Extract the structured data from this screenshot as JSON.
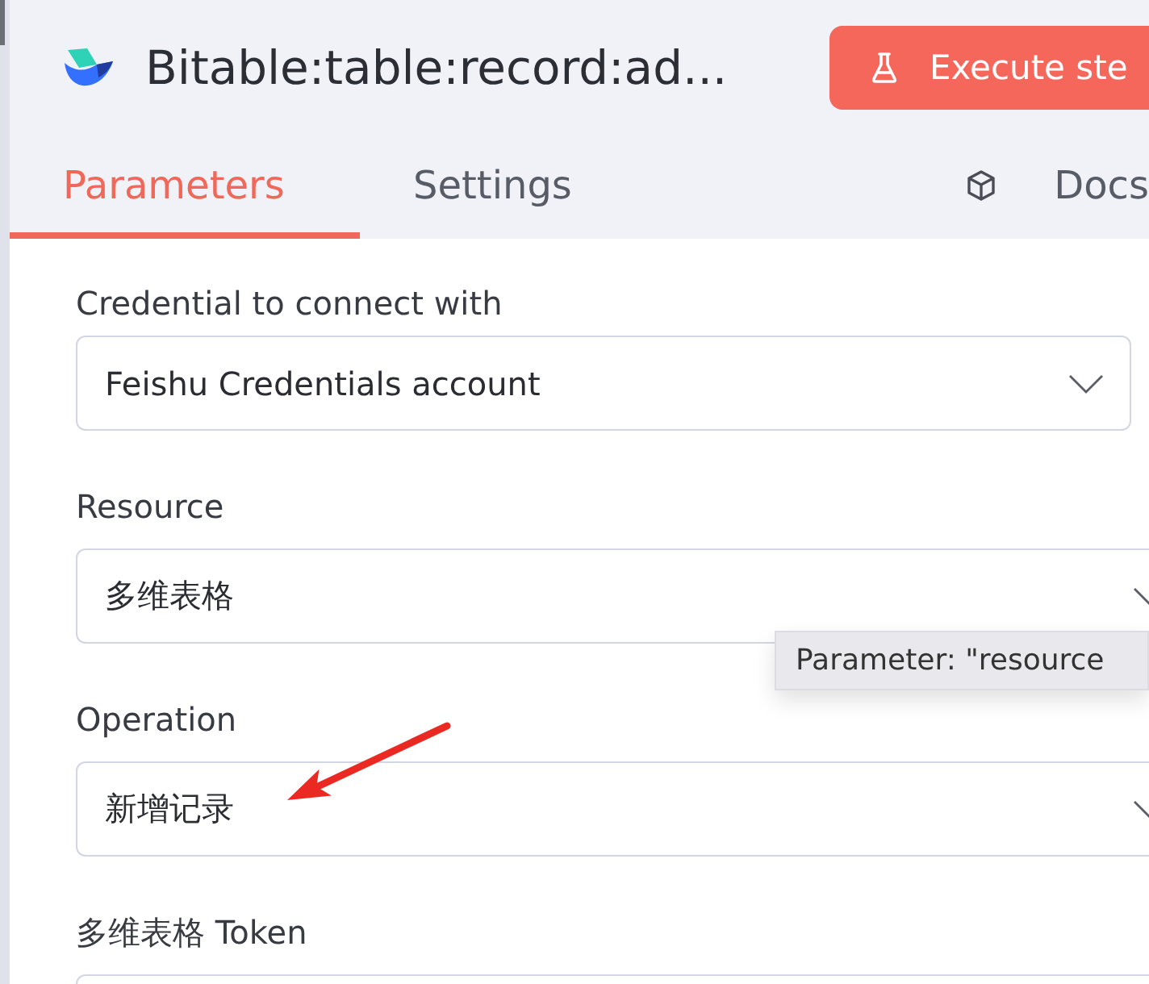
{
  "node": {
    "title": "Bitable:table:record:ad...",
    "execute_button": {
      "label": "Execute ste"
    }
  },
  "tabs": [
    {
      "label": "Parameters",
      "kind": "tab",
      "selected": true
    },
    {
      "label": "Settings",
      "kind": "tab",
      "selected": false
    },
    {
      "label": "Docs",
      "kind": "link",
      "selected": false
    }
  ],
  "fields": [
    {
      "kind": "credential",
      "label": "Credential to connect with",
      "value": "Feishu Credentials account"
    },
    {
      "kind": "select",
      "label": "Resource",
      "value": "多维表格",
      "tooltip": {
        "text": "Parameter: \"resource"
      }
    },
    {
      "kind": "select",
      "label": "Operation",
      "value": "新增记录"
    },
    {
      "kind": "input",
      "label": "多维表格 Token"
    }
  ]
}
